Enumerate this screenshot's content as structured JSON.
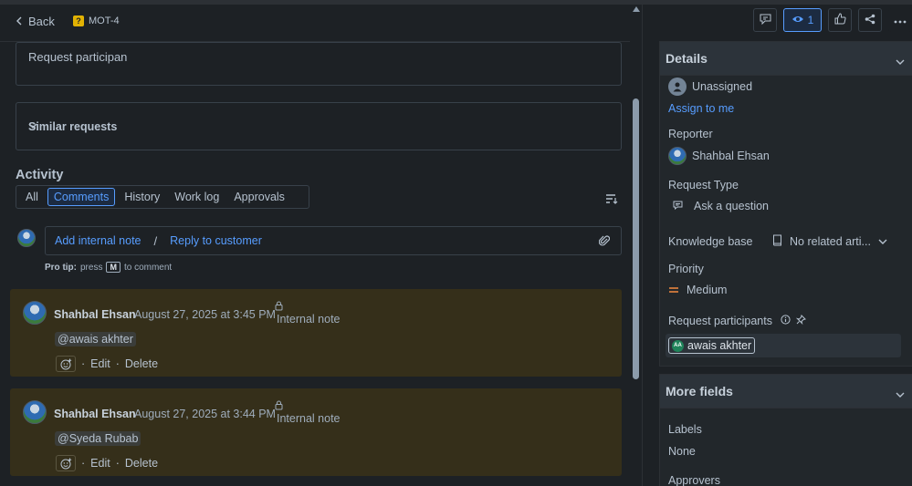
{
  "header": {
    "back_label": "Back",
    "ticket_key": "MOT-4"
  },
  "description": {
    "text": "Request participan"
  },
  "similar": {
    "title": "Similar requests"
  },
  "activity": {
    "heading": "Activity",
    "tabs": [
      {
        "label": "All",
        "selected": false
      },
      {
        "label": "Comments",
        "selected": true
      },
      {
        "label": "History",
        "selected": false
      },
      {
        "label": "Work log",
        "selected": false
      },
      {
        "label": "Approvals",
        "selected": false
      }
    ]
  },
  "reply": {
    "internal_note": "Add internal note",
    "separator": "/",
    "reply_customer": "Reply to customer",
    "protip_bold": "Pro tip:",
    "protip_press": "press",
    "protip_key": "M",
    "protip_rest": "to comment"
  },
  "comments": [
    {
      "author": "Shahbal Ehsan",
      "time": "August 27, 2025 at 3:45 PM",
      "visibility": "Internal note",
      "mention": "@awais akhter",
      "edit": "Edit",
      "delete": "Delete",
      "dot": "·"
    },
    {
      "author": "Shahbal Ehsan",
      "time": "August 27, 2025 at 3:44 PM",
      "visibility": "Internal note",
      "mention": "@Syeda Rubab",
      "edit": "Edit",
      "delete": "Delete",
      "dot": "·"
    }
  ],
  "toolbar": {
    "watch_count": "1"
  },
  "details": {
    "title": "Details",
    "assignee": "Unassigned",
    "assign_to_me": "Assign to me",
    "reporter_label": "Reporter",
    "reporter": "Shahbal Ehsan",
    "request_type_label": "Request Type",
    "request_type": "Ask a question",
    "kb_label": "Knowledge base",
    "kb_value": "No related arti...",
    "priority_label": "Priority",
    "priority": "Medium",
    "participants_label": "Request participants",
    "participant": "awais akhter",
    "participant_initials": "AA"
  },
  "more_fields": {
    "title": "More fields",
    "labels_label": "Labels",
    "labels_value": "None",
    "approvers_label": "Approvers"
  },
  "colors": {
    "accent": "#579dff",
    "note_bg": "#352f1a",
    "priority_medium": "#f38a3f"
  }
}
